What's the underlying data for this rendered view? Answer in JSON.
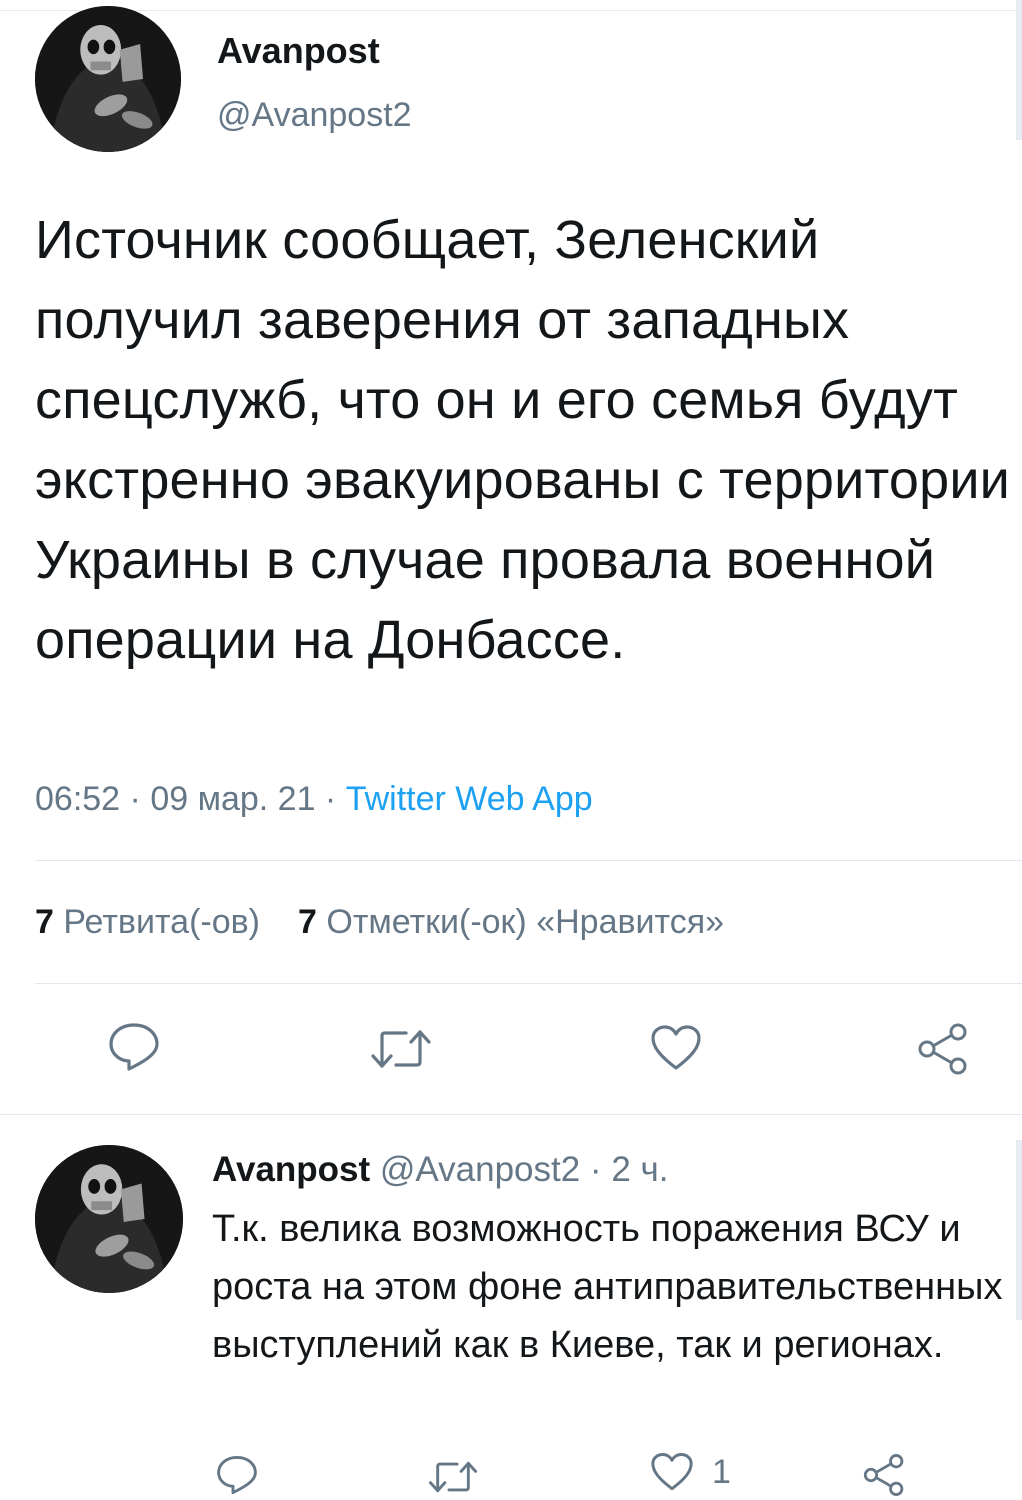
{
  "tweet": {
    "author_name": "Avanpost",
    "author_handle": "@Avanpost2",
    "text": "Источник сообщает, Зеленский получил заверения от западных спецслужб, что он и его семья будут экстренно эвакуированы с территории Украины в случае провала военной операции на Донбассе.",
    "time": "06:52",
    "date": "09 мар. 21",
    "source": "Twitter Web App",
    "retweet_count": "7",
    "retweet_label": "Ретвита(-ов)",
    "like_count": "7",
    "like_label": "Отметки(-ок) «Нравится»"
  },
  "reply": {
    "author_name": "Avanpost",
    "author_handle": "@Avanpost2",
    "time": "2 ч.",
    "text": "Т.к. велика возможность поражения ВСУ и роста на этом фоне антиправительственных выступлений как в Киеве, так и регионах.",
    "like_count": "1"
  },
  "separators": {
    "dot": " · "
  },
  "icons": [
    "reply-icon",
    "retweet-icon",
    "like-icon",
    "share-icon"
  ],
  "colors": {
    "link": "#1da1f2",
    "secondary": "#657786",
    "text": "#14171a"
  }
}
